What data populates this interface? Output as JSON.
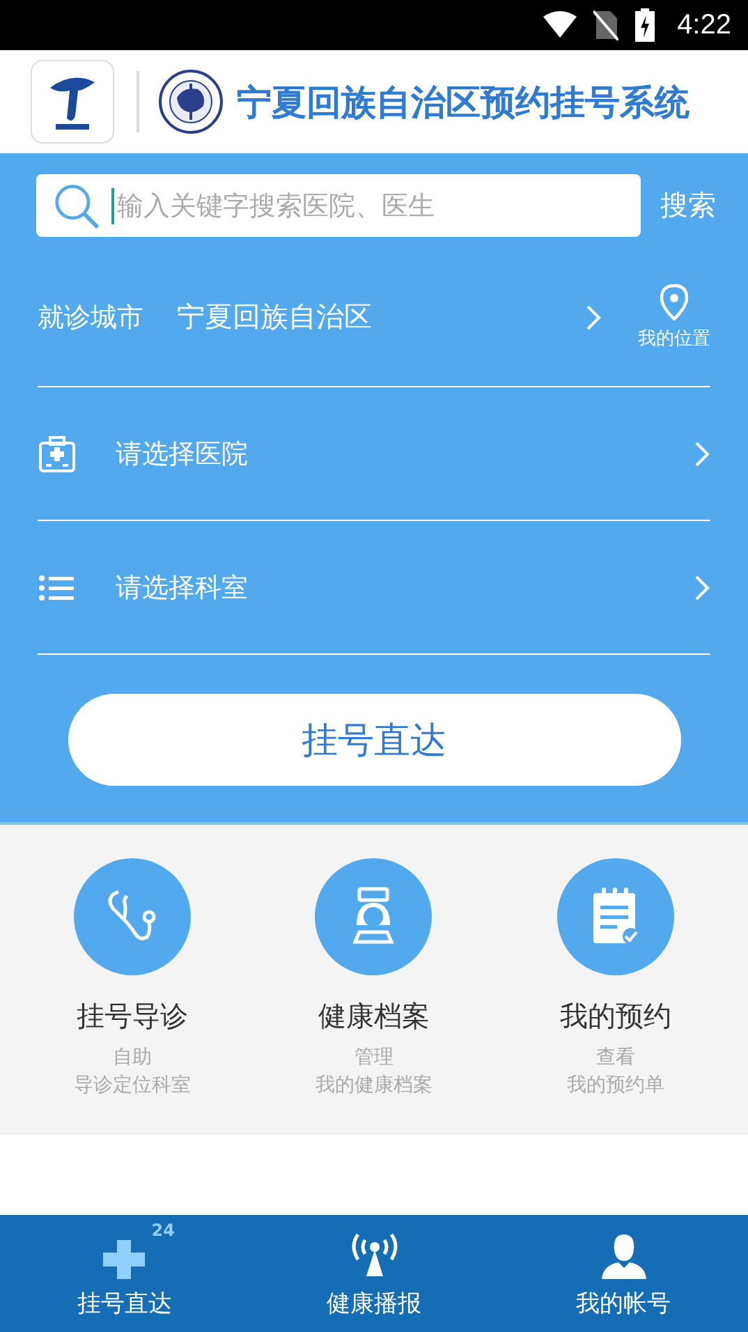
{
  "status_bar": {
    "time": "4:22"
  },
  "header": {
    "title": "宁夏回族自治区预约挂号系统"
  },
  "search": {
    "placeholder": "输入关键字搜索医院、医生",
    "button": "搜索"
  },
  "city": {
    "label": "就诊城市",
    "value": "宁夏回族自治区",
    "location": "我的位置"
  },
  "selects": [
    {
      "kind": "hospital",
      "label": "请选择医院"
    },
    {
      "kind": "department",
      "label": "请选择科室"
    }
  ],
  "submit": "挂号直达",
  "features": [
    {
      "kind": "stethoscope",
      "title": "挂号导诊",
      "lines": [
        "自助",
        "导诊定位科室"
      ]
    },
    {
      "kind": "nurse",
      "title": "健康档案",
      "lines": [
        "管理",
        "我的健康档案"
      ]
    },
    {
      "kind": "notepad",
      "title": "我的预约",
      "lines": [
        "查看",
        "我的预约单"
      ]
    }
  ],
  "tabs": [
    {
      "kind": "cross",
      "label": "挂号直达",
      "badge": "24",
      "selected": true
    },
    {
      "kind": "broadcast",
      "label": "健康播报",
      "selected": false
    },
    {
      "kind": "person",
      "label": "我的帐号",
      "selected": false
    }
  ]
}
